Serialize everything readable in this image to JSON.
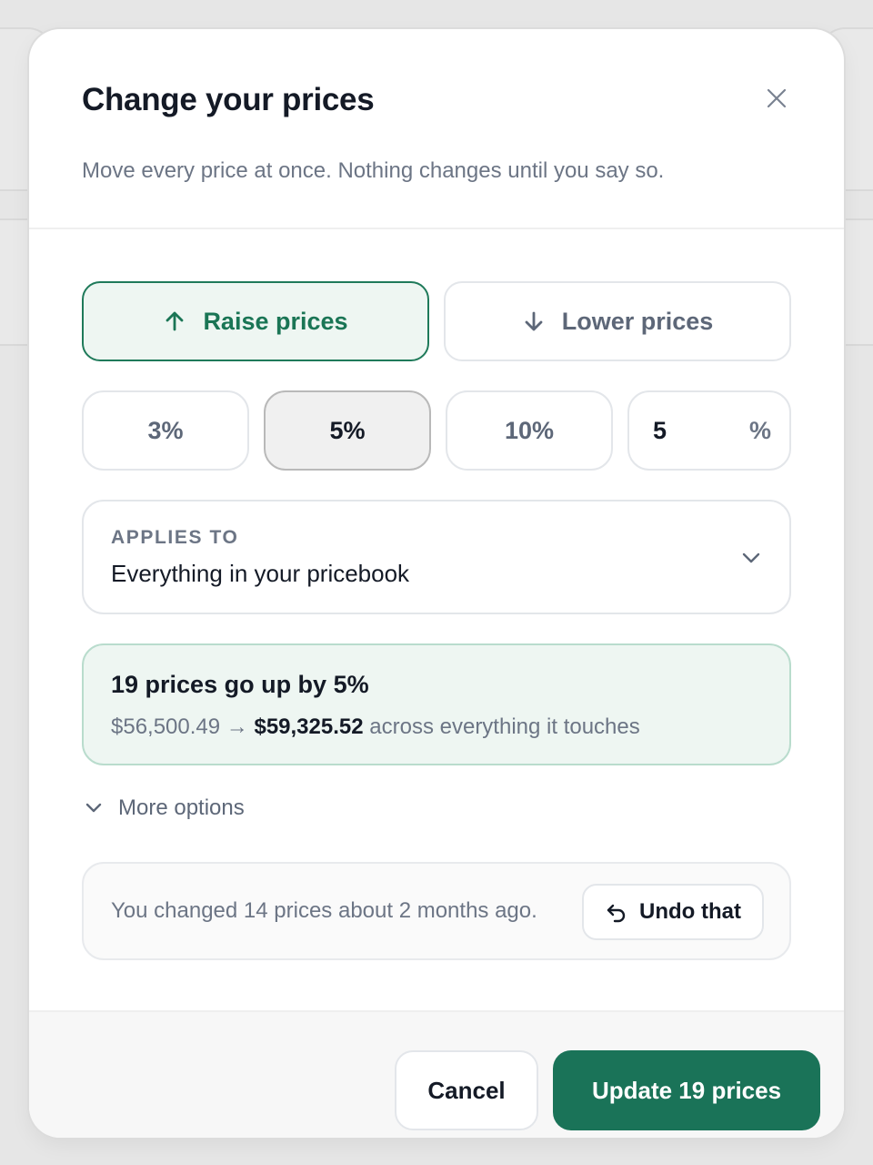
{
  "dialog": {
    "title": "Change your prices",
    "subtitle": "Move every price at once. Nothing changes until you say so."
  },
  "direction": {
    "raise_label": "Raise prices",
    "lower_label": "Lower prices",
    "selected": "raise"
  },
  "percent": {
    "options": [
      "3%",
      "5%",
      "10%"
    ],
    "selected": "5%",
    "custom_value": "5",
    "custom_unit": "%"
  },
  "applies_to": {
    "label": "APPLIES TO",
    "value": "Everything in your pricebook"
  },
  "summary": {
    "headline": "19 prices go up by 5%",
    "old_total": "$56,500.49",
    "arrow": "→",
    "new_total": "$59,325.52",
    "suffix": "across everything it touches"
  },
  "more_options": {
    "label": "More options"
  },
  "history": {
    "message": "You changed 14 prices about 2 months ago.",
    "undo_label": "Undo that"
  },
  "footer": {
    "cancel_label": "Cancel",
    "update_label": "Update 19 prices"
  },
  "colors": {
    "accent": "#1a7358",
    "accent_light": "#eef6f2",
    "text_primary": "#141a26",
    "text_muted": "#6c7585"
  },
  "icons": {
    "close": "close-icon",
    "raise": "arrow-up-icon",
    "lower": "arrow-down-icon",
    "dropdown": "chevron-down-icon",
    "more": "chevron-down-icon",
    "undo": "undo-icon"
  }
}
